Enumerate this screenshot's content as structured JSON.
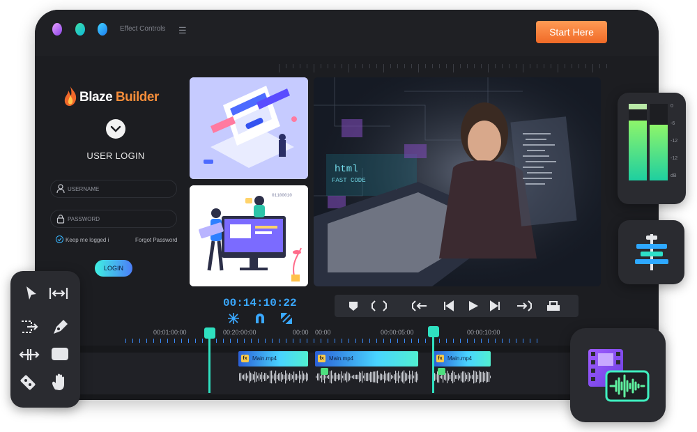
{
  "window": {
    "title": "Effect Controls",
    "cta_label": "Start Here"
  },
  "login": {
    "brand_part1": "Blaze",
    "brand_part2": "Builder",
    "heading": "USER LOGIN",
    "username_placeholder": "USERNAME",
    "password_placeholder": "PASSWORD",
    "remember_label": "Keep me logged i",
    "forgot_label": "Forgot Password",
    "login_button": "LOGIN"
  },
  "preview": {
    "timecode": "00:14:10:22"
  },
  "timeline": {
    "ruler_labels": [
      "00:01:00:00",
      "00:20:00:00",
      "00:00",
      "00:00",
      "00:00:05:00",
      "00:00:10:00"
    ],
    "clips": [
      {
        "name": "Main.mp4",
        "badge": "fx"
      },
      {
        "name": "Main.mp4",
        "badge": "fx"
      },
      {
        "name": "Main.mp4",
        "badge": "fx"
      }
    ]
  },
  "meter": {
    "labels": [
      "0",
      "-6",
      "-12",
      "-12",
      "dB"
    ]
  },
  "icons": {
    "tools": [
      "select-arrow-icon",
      "ripple-edit-icon",
      "slip-icon",
      "pen-icon",
      "move-icon",
      "rectangle-icon",
      "razor-icon",
      "hand-icon"
    ],
    "transport": [
      "marker-icon",
      "mark-in-out-icon",
      "go-to-in-icon",
      "step-back-icon",
      "play-icon",
      "step-forward-icon",
      "go-to-out-icon",
      "export-frame-icon"
    ]
  },
  "colors": {
    "accent_cta": "#f27a30",
    "timecode": "#3aa8ff",
    "playhead": "#2fe0c0",
    "panel_bg": "#2a2b30",
    "frame_bg": "#1c1d21"
  }
}
